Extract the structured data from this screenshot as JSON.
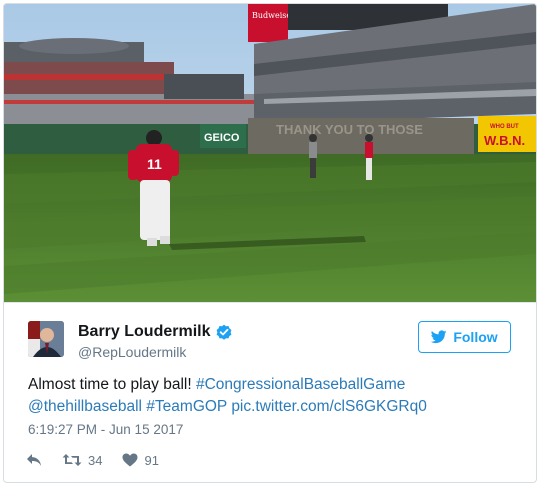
{
  "media": {
    "alt_signs": {
      "geico": "GEICO",
      "thank_you": "THANK YOU TO THOSE",
      "wbn_top": "WHO BUT",
      "wbn_bottom": "W.B.N.",
      "budweiser": "Budweiser"
    },
    "jersey_number": "11"
  },
  "user": {
    "display_name": "Barry Loudermilk",
    "handle": "@RepLoudermilk",
    "verified": true
  },
  "follow_button": {
    "label": "Follow",
    "icon": "twitter-bird-icon"
  },
  "tweet": {
    "text_plain": "Almost time to play ball! ",
    "hashtag_1": "#CongressionalBaseballGame",
    "mention": "@thehillbaseball",
    "hashtag_2": "#TeamGOP",
    "link": "pic.twitter.com/clS6GKGRq0",
    "timestamp": "6:19:27 PM - Jun 15 2017"
  },
  "actions": {
    "reply_icon": "reply-icon",
    "retweet_icon": "retweet-icon",
    "retweet_count": "34",
    "like_icon": "heart-icon",
    "like_count": "91"
  },
  "colors": {
    "accent": "#1da1f2",
    "link": "#2b7bb9",
    "secondary_text": "#657786",
    "grass": "#4f7d2e"
  }
}
